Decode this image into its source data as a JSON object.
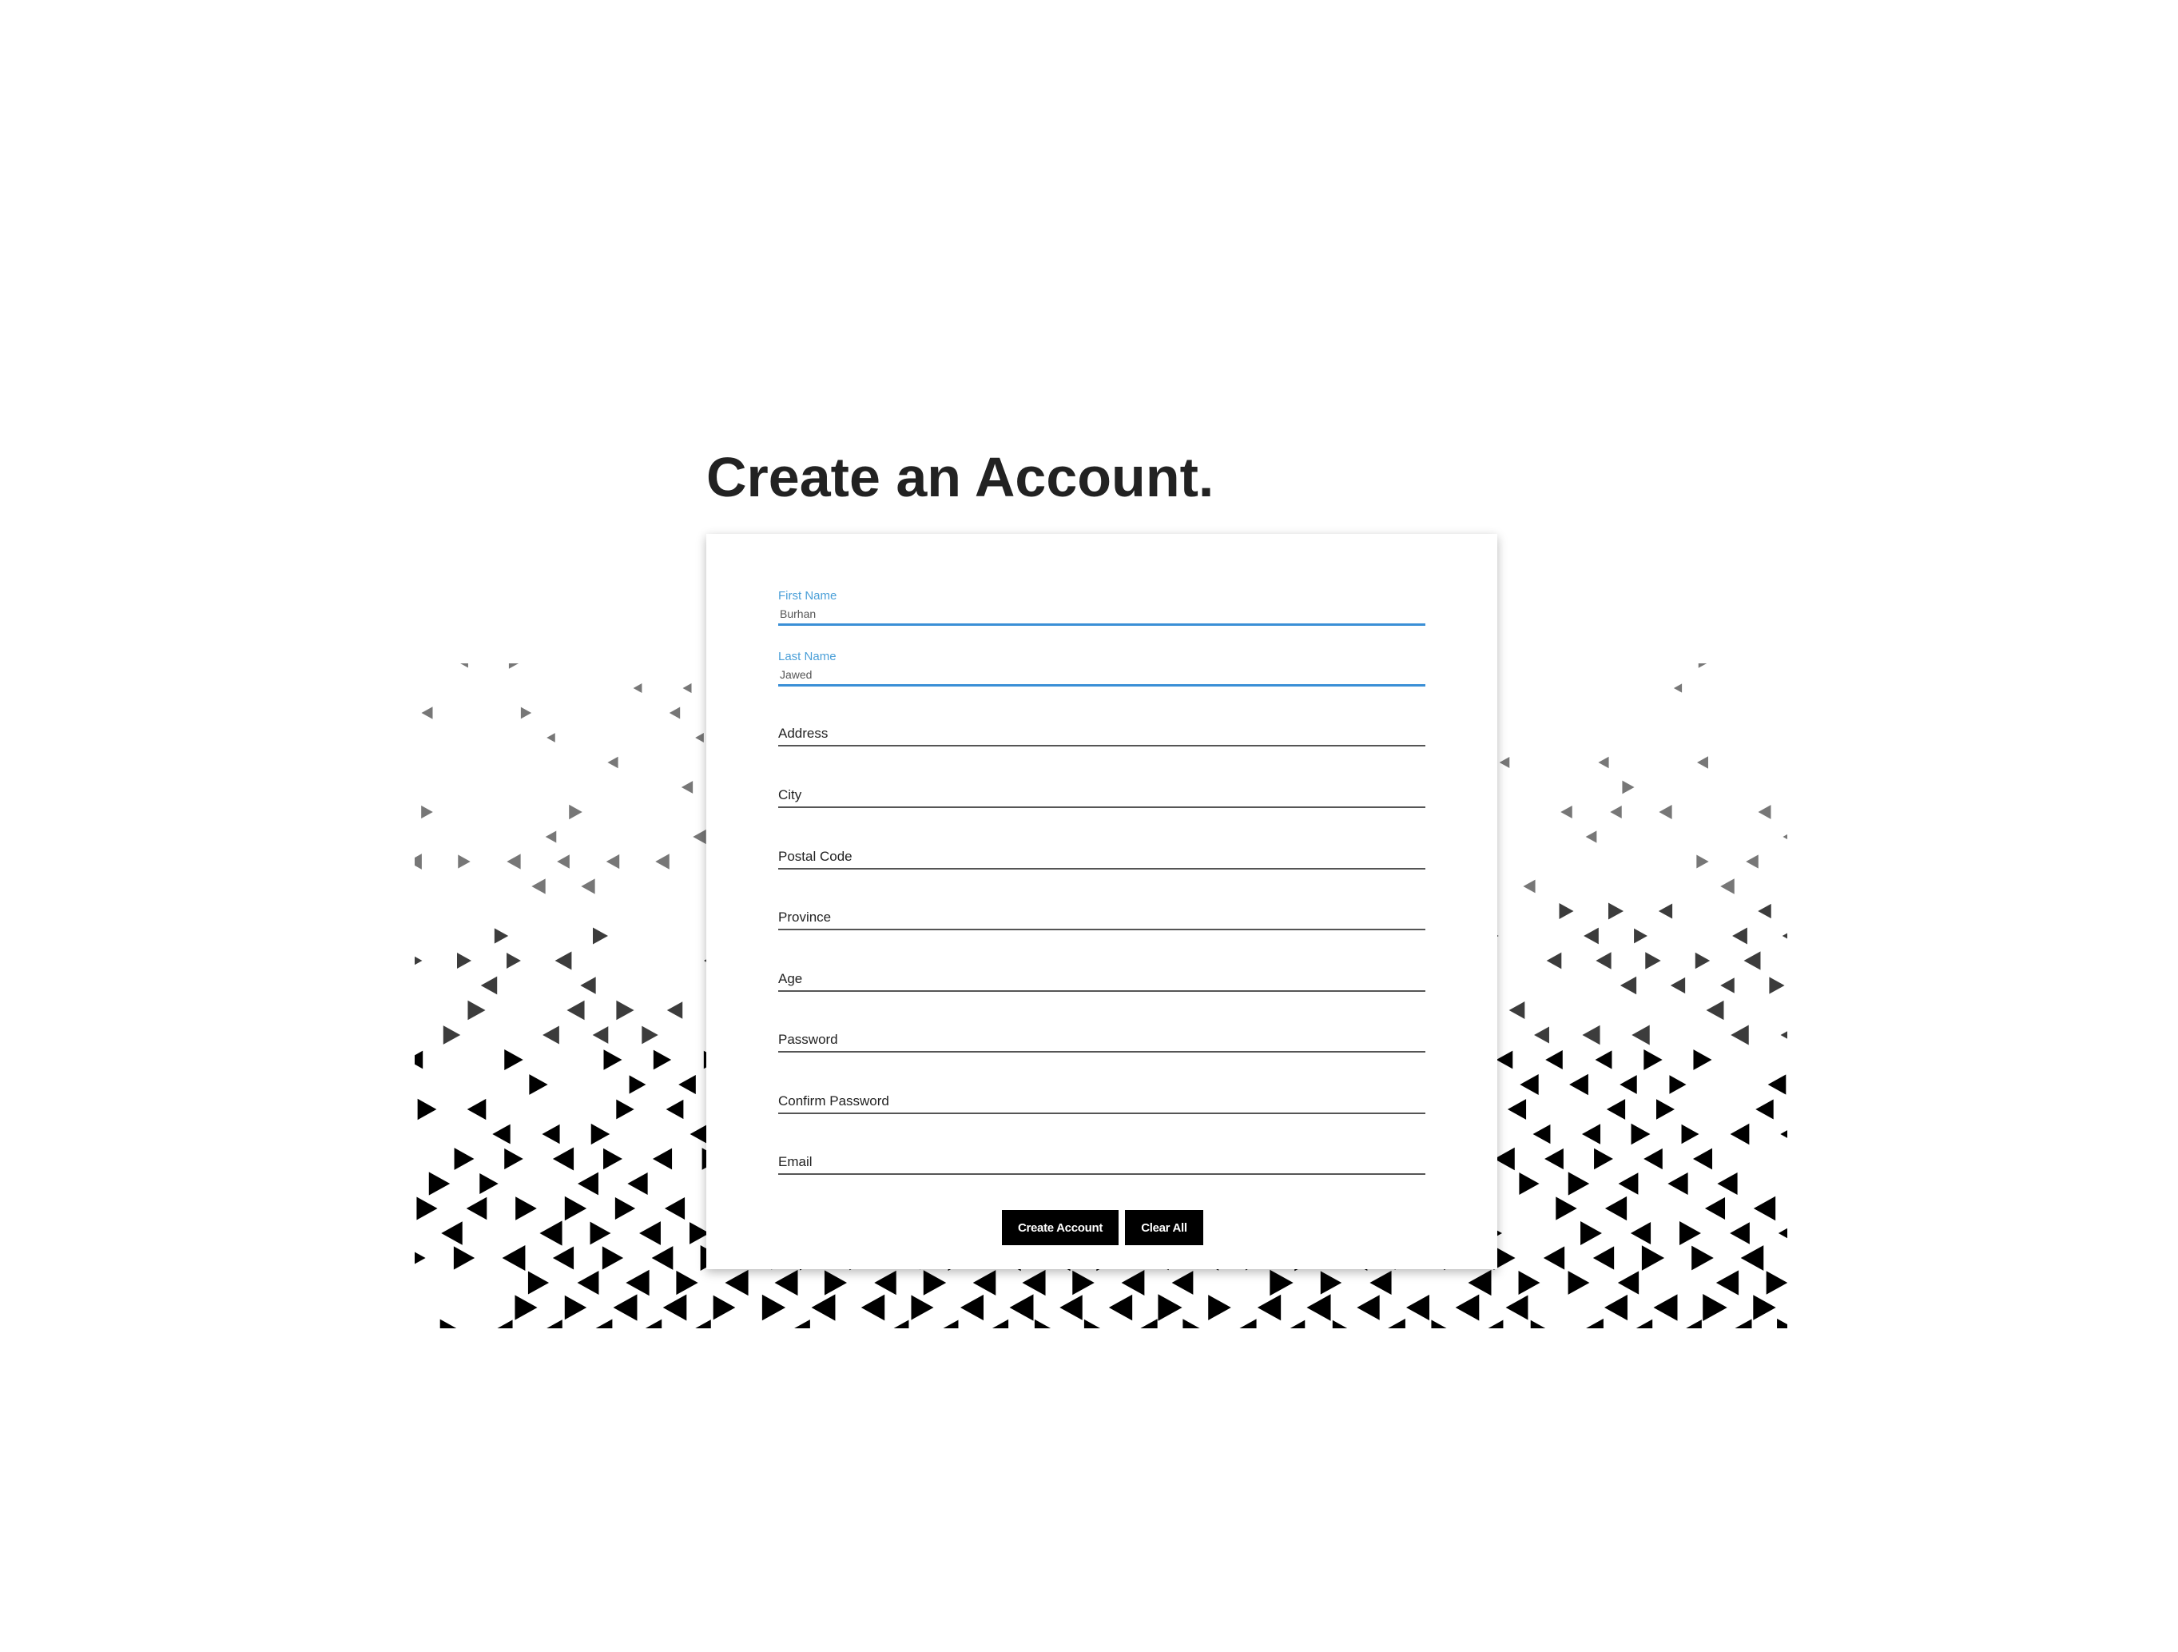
{
  "page": {
    "title": "Create an Account."
  },
  "form": {
    "fields": [
      {
        "label": "First Name",
        "value": "Burhan"
      },
      {
        "label": "Last Name",
        "value": "Jawed"
      },
      {
        "label": "Address",
        "value": ""
      },
      {
        "label": "City",
        "value": ""
      },
      {
        "label": "Postal Code",
        "value": ""
      },
      {
        "label": "Province",
        "value": ""
      },
      {
        "label": "Age",
        "value": ""
      },
      {
        "label": "Password",
        "value": ""
      },
      {
        "label": "Confirm Password",
        "value": ""
      },
      {
        "label": "Email",
        "value": ""
      }
    ],
    "buttons": {
      "create": "Create Account",
      "clear": "Clear All"
    }
  },
  "colors": {
    "accent": "#3a8fd6",
    "button_bg": "#000000",
    "pattern": "#000000"
  },
  "icons": {
    "background": "triangle-pattern"
  }
}
